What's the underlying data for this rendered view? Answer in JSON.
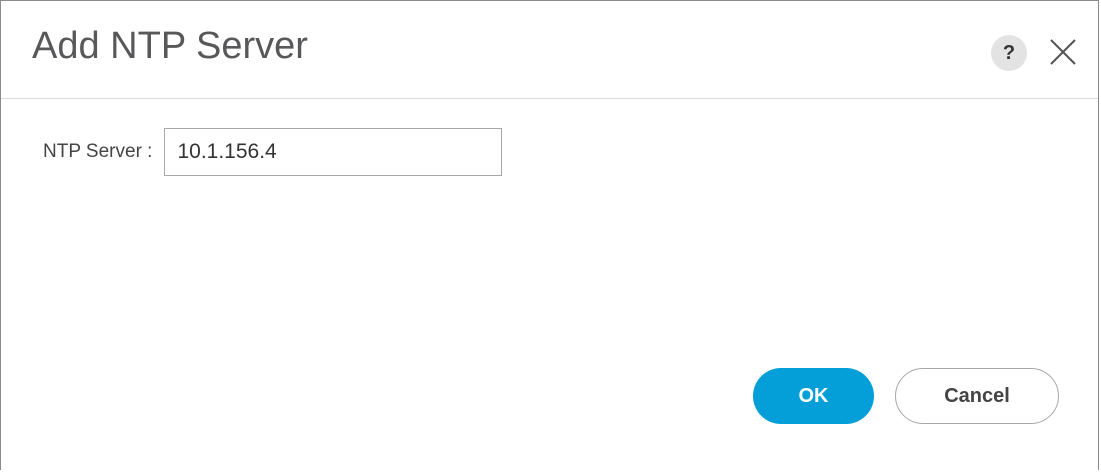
{
  "dialog": {
    "title": "Add NTP Server",
    "help_label": "?",
    "help_icon": "question-mark-icon",
    "close_icon": "close-x-icon"
  },
  "form": {
    "ntp_server_label": "NTP Server :",
    "ntp_server_value": "10.1.156.4"
  },
  "actions": {
    "ok_label": "OK",
    "cancel_label": "Cancel",
    "ok_color": "#049fd9"
  }
}
